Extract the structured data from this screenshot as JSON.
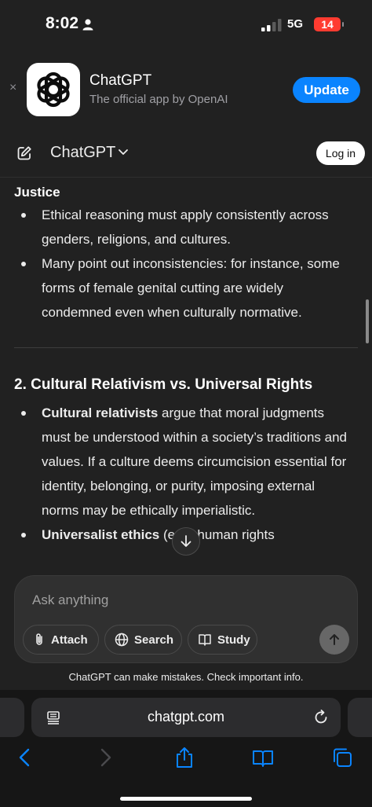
{
  "status": {
    "time": "8:02",
    "network": "5G",
    "battery": "14"
  },
  "banner": {
    "close_label": "×",
    "app_name": "ChatGPT",
    "app_subtitle": "The official app by OpenAI",
    "update_label": "Update"
  },
  "header": {
    "title": "ChatGPT",
    "login_label": "Log in"
  },
  "content": {
    "partial_heading": "Justice",
    "justice_bullets": [
      "Ethical reasoning must apply consistently across genders, religions, and cultures.",
      "Many point out inconsistencies: for instance, some forms of female genital cutting are widely condemned even when culturally normative."
    ],
    "section2_title": "2. Cultural Relativism vs. Universal Rights",
    "section2_bullets": [
      {
        "bold": "Cultural relativists",
        "text": " argue that moral judgments must be understood within a society’s traditions and values. If a culture deems circumcision essential for identity, belonging, or purity, imposing external norms may be ethically imperialistic."
      },
      {
        "bold": "Universalist ethics",
        "text": " (e.g., human rights"
      }
    ]
  },
  "composer": {
    "placeholder": "Ask anything",
    "attach_label": "Attach",
    "search_label": "Search",
    "study_label": "Study"
  },
  "disclaimer": "ChatGPT can make mistakes. Check important info.",
  "browser": {
    "url": "chatgpt.com"
  },
  "colors": {
    "background": "#212121",
    "accent": "#0a84ff",
    "browser_bar": "#161616"
  }
}
